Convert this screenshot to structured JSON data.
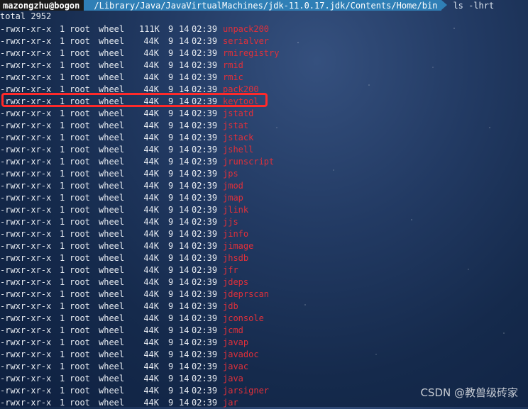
{
  "prompt": {
    "user": "mazongzhu@bogon",
    "path": "/Library/Java/JavaVirtualMachines/jdk-11.0.17.jdk/Contents/Home/bin",
    "command": "ls -lhrt"
  },
  "total_line": "total 2952",
  "files": [
    {
      "perm": "-rwxr-xr-x",
      "links": "1",
      "owner": "root",
      "group": "wheel",
      "size": "111K",
      "month": "9",
      "day": "14",
      "time": "02:39",
      "name": "unpack200"
    },
    {
      "perm": "-rwxr-xr-x",
      "links": "1",
      "owner": "root",
      "group": "wheel",
      "size": "44K",
      "month": "9",
      "day": "14",
      "time": "02:39",
      "name": "serialver"
    },
    {
      "perm": "-rwxr-xr-x",
      "links": "1",
      "owner": "root",
      "group": "wheel",
      "size": "44K",
      "month": "9",
      "day": "14",
      "time": "02:39",
      "name": "rmiregistry"
    },
    {
      "perm": "-rwxr-xr-x",
      "links": "1",
      "owner": "root",
      "group": "wheel",
      "size": "44K",
      "month": "9",
      "day": "14",
      "time": "02:39",
      "name": "rmid"
    },
    {
      "perm": "-rwxr-xr-x",
      "links": "1",
      "owner": "root",
      "group": "wheel",
      "size": "44K",
      "month": "9",
      "day": "14",
      "time": "02:39",
      "name": "rmic"
    },
    {
      "perm": "-rwxr-xr-x",
      "links": "1",
      "owner": "root",
      "group": "wheel",
      "size": "44K",
      "month": "9",
      "day": "14",
      "time": "02:39",
      "name": "pack200"
    },
    {
      "perm": "-rwxr-xr-x",
      "links": "1",
      "owner": "root",
      "group": "wheel",
      "size": "44K",
      "month": "9",
      "day": "14",
      "time": "02:39",
      "name": "keytool"
    },
    {
      "perm": "-rwxr-xr-x",
      "links": "1",
      "owner": "root",
      "group": "wheel",
      "size": "44K",
      "month": "9",
      "day": "14",
      "time": "02:39",
      "name": "jstatd"
    },
    {
      "perm": "-rwxr-xr-x",
      "links": "1",
      "owner": "root",
      "group": "wheel",
      "size": "44K",
      "month": "9",
      "day": "14",
      "time": "02:39",
      "name": "jstat"
    },
    {
      "perm": "-rwxr-xr-x",
      "links": "1",
      "owner": "root",
      "group": "wheel",
      "size": "44K",
      "month": "9",
      "day": "14",
      "time": "02:39",
      "name": "jstack"
    },
    {
      "perm": "-rwxr-xr-x",
      "links": "1",
      "owner": "root",
      "group": "wheel",
      "size": "44K",
      "month": "9",
      "day": "14",
      "time": "02:39",
      "name": "jshell"
    },
    {
      "perm": "-rwxr-xr-x",
      "links": "1",
      "owner": "root",
      "group": "wheel",
      "size": "44K",
      "month": "9",
      "day": "14",
      "time": "02:39",
      "name": "jrunscript"
    },
    {
      "perm": "-rwxr-xr-x",
      "links": "1",
      "owner": "root",
      "group": "wheel",
      "size": "44K",
      "month": "9",
      "day": "14",
      "time": "02:39",
      "name": "jps"
    },
    {
      "perm": "-rwxr-xr-x",
      "links": "1",
      "owner": "root",
      "group": "wheel",
      "size": "44K",
      "month": "9",
      "day": "14",
      "time": "02:39",
      "name": "jmod"
    },
    {
      "perm": "-rwxr-xr-x",
      "links": "1",
      "owner": "root",
      "group": "wheel",
      "size": "44K",
      "month": "9",
      "day": "14",
      "time": "02:39",
      "name": "jmap"
    },
    {
      "perm": "-rwxr-xr-x",
      "links": "1",
      "owner": "root",
      "group": "wheel",
      "size": "44K",
      "month": "9",
      "day": "14",
      "time": "02:39",
      "name": "jlink"
    },
    {
      "perm": "-rwxr-xr-x",
      "links": "1",
      "owner": "root",
      "group": "wheel",
      "size": "44K",
      "month": "9",
      "day": "14",
      "time": "02:39",
      "name": "jjs"
    },
    {
      "perm": "-rwxr-xr-x",
      "links": "1",
      "owner": "root",
      "group": "wheel",
      "size": "44K",
      "month": "9",
      "day": "14",
      "time": "02:39",
      "name": "jinfo"
    },
    {
      "perm": "-rwxr-xr-x",
      "links": "1",
      "owner": "root",
      "group": "wheel",
      "size": "44K",
      "month": "9",
      "day": "14",
      "time": "02:39",
      "name": "jimage"
    },
    {
      "perm": "-rwxr-xr-x",
      "links": "1",
      "owner": "root",
      "group": "wheel",
      "size": "44K",
      "month": "9",
      "day": "14",
      "time": "02:39",
      "name": "jhsdb"
    },
    {
      "perm": "-rwxr-xr-x",
      "links": "1",
      "owner": "root",
      "group": "wheel",
      "size": "44K",
      "month": "9",
      "day": "14",
      "time": "02:39",
      "name": "jfr"
    },
    {
      "perm": "-rwxr-xr-x",
      "links": "1",
      "owner": "root",
      "group": "wheel",
      "size": "44K",
      "month": "9",
      "day": "14",
      "time": "02:39",
      "name": "jdeps"
    },
    {
      "perm": "-rwxr-xr-x",
      "links": "1",
      "owner": "root",
      "group": "wheel",
      "size": "44K",
      "month": "9",
      "day": "14",
      "time": "02:39",
      "name": "jdeprscan"
    },
    {
      "perm": "-rwxr-xr-x",
      "links": "1",
      "owner": "root",
      "group": "wheel",
      "size": "44K",
      "month": "9",
      "day": "14",
      "time": "02:39",
      "name": "jdb"
    },
    {
      "perm": "-rwxr-xr-x",
      "links": "1",
      "owner": "root",
      "group": "wheel",
      "size": "44K",
      "month": "9",
      "day": "14",
      "time": "02:39",
      "name": "jconsole"
    },
    {
      "perm": "-rwxr-xr-x",
      "links": "1",
      "owner": "root",
      "group": "wheel",
      "size": "44K",
      "month": "9",
      "day": "14",
      "time": "02:39",
      "name": "jcmd"
    },
    {
      "perm": "-rwxr-xr-x",
      "links": "1",
      "owner": "root",
      "group": "wheel",
      "size": "44K",
      "month": "9",
      "day": "14",
      "time": "02:39",
      "name": "javap"
    },
    {
      "perm": "-rwxr-xr-x",
      "links": "1",
      "owner": "root",
      "group": "wheel",
      "size": "44K",
      "month": "9",
      "day": "14",
      "time": "02:39",
      "name": "javadoc"
    },
    {
      "perm": "-rwxr-xr-x",
      "links": "1",
      "owner": "root",
      "group": "wheel",
      "size": "44K",
      "month": "9",
      "day": "14",
      "time": "02:39",
      "name": "javac"
    },
    {
      "perm": "-rwxr-xr-x",
      "links": "1",
      "owner": "root",
      "group": "wheel",
      "size": "44K",
      "month": "9",
      "day": "14",
      "time": "02:39",
      "name": "java"
    },
    {
      "perm": "-rwxr-xr-x",
      "links": "1",
      "owner": "root",
      "group": "wheel",
      "size": "44K",
      "month": "9",
      "day": "14",
      "time": "02:39",
      "name": "jarsigner"
    },
    {
      "perm": "-rwxr-xr-x",
      "links": "1",
      "owner": "root",
      "group": "wheel",
      "size": "44K",
      "month": "9",
      "day": "14",
      "time": "02:39",
      "name": "jar"
    }
  ],
  "highlighted_file": "keytool",
  "watermark": "CSDN @教兽级砖家",
  "colors": {
    "filename": "#e0303a",
    "highlight_border": "#ff2a2a",
    "path_segment": "#2f7fb6",
    "user_segment": "#1b1b1b"
  }
}
